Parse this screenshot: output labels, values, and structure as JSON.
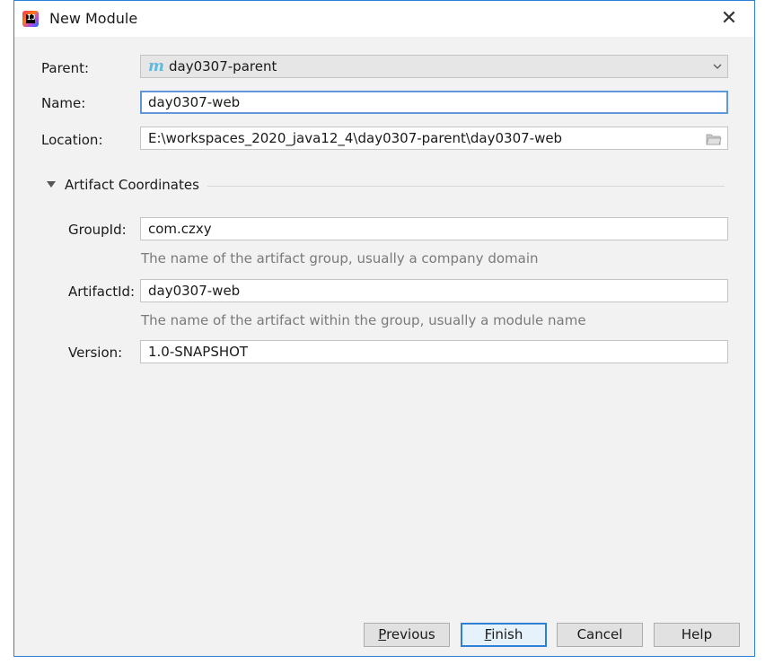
{
  "window": {
    "title": "New Module",
    "close_symbol": "✕"
  },
  "form": {
    "parent": {
      "label": "Parent:",
      "value": "day0307-parent",
      "icon_letter": "m"
    },
    "name": {
      "label": "Name:",
      "value": "day0307-web"
    },
    "location": {
      "label": "Location:",
      "value": "E:\\workspaces_2020_java12_4\\day0307-parent\\day0307-web"
    }
  },
  "artifact": {
    "section_title": "Artifact Coordinates",
    "group_id": {
      "label": "GroupId:",
      "value": "com.czxy",
      "hint": "The name of the artifact group, usually a company domain"
    },
    "artifact_id": {
      "label": "ArtifactId:",
      "value": "day0307-web",
      "hint": "The name of the artifact within the group, usually a module name"
    },
    "version": {
      "label": "Version:",
      "value": "1.0-SNAPSHOT"
    }
  },
  "buttons": {
    "previous_mnemonic": "P",
    "previous_rest": "revious",
    "finish_mnemonic": "F",
    "finish_rest": "inish",
    "cancel": "Cancel",
    "help": "Help"
  },
  "colors": {
    "accent": "#2f7fd5",
    "maven_icon": "#5fb8de",
    "hint_text": "#7a7a7a"
  },
  "icons": {
    "app": "intellij-idea-icon",
    "parent": "maven-module-icon",
    "browse": "folder-icon",
    "collapse": "triangle-down-icon"
  }
}
